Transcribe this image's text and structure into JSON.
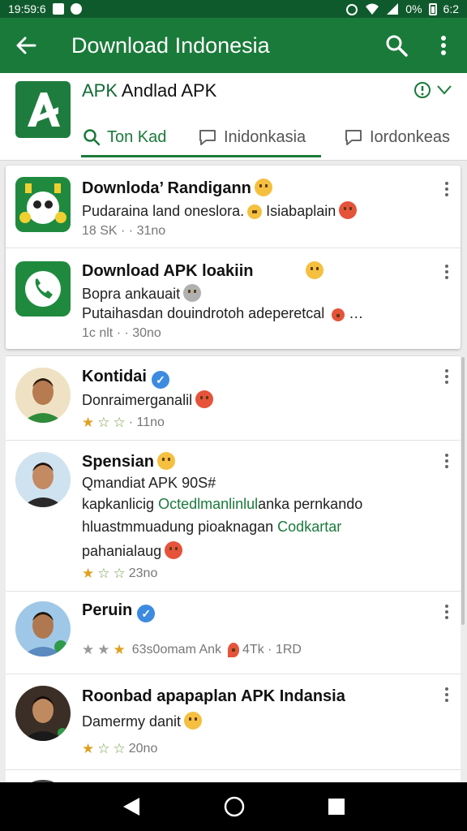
{
  "status_bar": {
    "time_left": "19:59:6",
    "battery": "0%",
    "time_right": "6:2"
  },
  "app_bar": {
    "title": "Download Indonesia"
  },
  "header": {
    "app_name_green": "APK",
    "app_name_rest": " Andlad APK",
    "tabs": [
      {
        "label": "Ton Kad",
        "active": true
      },
      {
        "label": "Inidonkasia",
        "active": false
      },
      {
        "label": "Iordonkeas",
        "active": false
      }
    ]
  },
  "apps": [
    {
      "title": "Downloda’ Randigann",
      "line1": "Pudaraina land oneslora.",
      "line1b": "Isiabaplain",
      "meta": "18 SK · · 31no"
    },
    {
      "title": "Download APK loakiin",
      "line1": "Bopra ankauait",
      "line2": "Putaihasdan douindrotoh adeperetcal",
      "line2_suffix": "…",
      "meta": "1c nlt · · 30no"
    }
  ],
  "posts": [
    {
      "name": "Kontidai",
      "line1": "Donraimerganalil",
      "meta": "· 11no",
      "rating": 3
    },
    {
      "name": "Spensian",
      "line1": "Qmandiat APK 90S#",
      "line2_a": "kapkanlicig ",
      "line2_link": "Octedlmanlinlul",
      "line2_b": "anka pernkando",
      "line3_a": "hluastmmuadung pioaknagan ",
      "line3_link": "Codkartar",
      "line4": "pahanialaug",
      "meta": "23no",
      "rating": 3
    },
    {
      "name": "Peruin",
      "meta": "63s0omam Ank",
      "meta2": "4Tk · 1RD",
      "rating": 3
    },
    {
      "name": "Roonbad apapaplan APK Indansia",
      "line1": "Damermy danit",
      "meta": "20no",
      "rating": 3
    }
  ],
  "colors": {
    "primary": "#1a7a3a",
    "status_bar": "#0f5a2c",
    "link": "#1a7a3a"
  }
}
